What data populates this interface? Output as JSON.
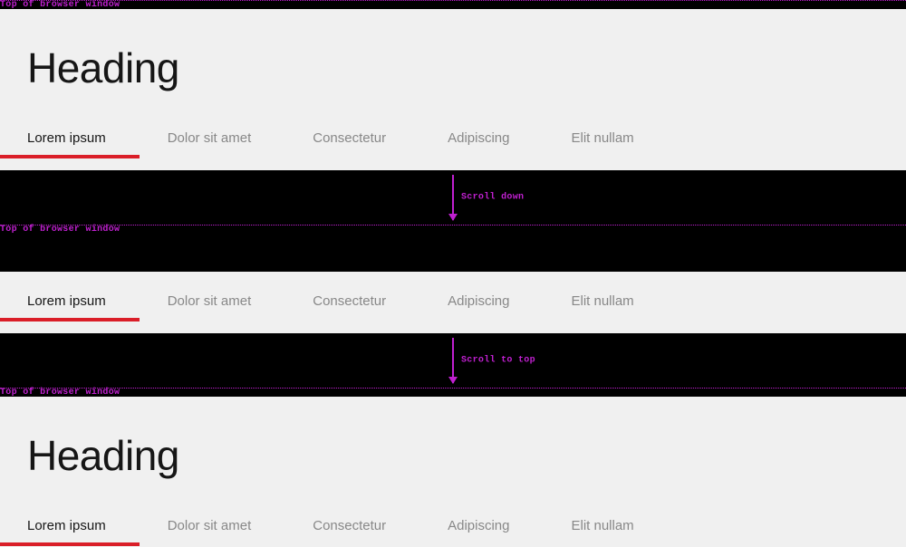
{
  "heading": "Heading",
  "tabs": [
    {
      "label": "Lorem ipsum",
      "active": true
    },
    {
      "label": "Dolor sit amet",
      "active": false
    },
    {
      "label": "Consectetur",
      "active": false
    },
    {
      "label": "Adipiscing",
      "active": false
    },
    {
      "label": "Elit nullam",
      "active": false
    }
  ],
  "annotations": {
    "viewport_label": "Top of browser window",
    "scroll_down_label": "Scroll down",
    "scroll_to_top_label": "Scroll to top"
  },
  "colors": {
    "accent": "#da1e28",
    "annotation": "#c020d0"
  }
}
